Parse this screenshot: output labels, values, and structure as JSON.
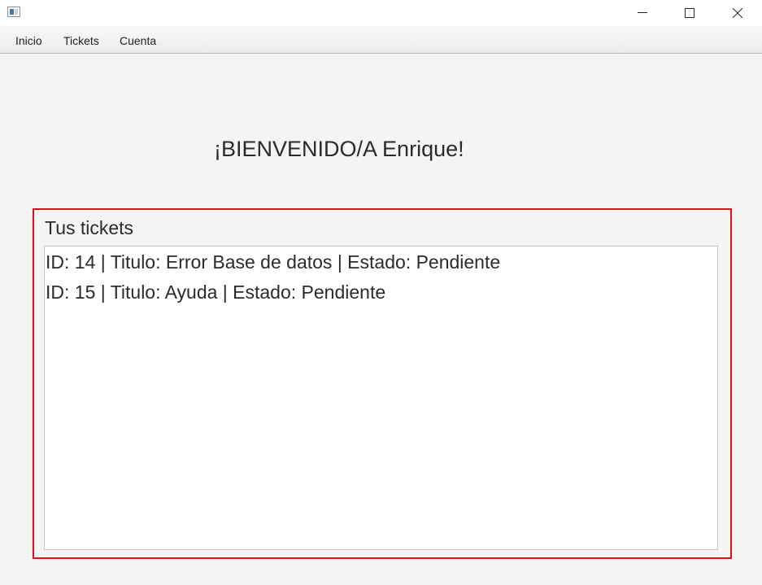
{
  "menubar": {
    "items": [
      {
        "label": "Inicio"
      },
      {
        "label": "Tickets"
      },
      {
        "label": "Cuenta"
      }
    ]
  },
  "main": {
    "welcome_text": "¡BIENVENIDO/A Enrique!",
    "tickets_label": "Tus tickets",
    "tickets": [
      {
        "text": "ID: 14 | Titulo: Error Base de datos | Estado: Pendiente"
      },
      {
        "text": "ID: 15 | Titulo: Ayuda | Estado: Pendiente"
      }
    ]
  },
  "colors": {
    "highlight_border": "#e0101b",
    "window_background": "#f4f4f4",
    "list_background": "#ffffff"
  },
  "icons": {
    "app": "app-window-icon",
    "minimize": "minimize-icon",
    "maximize": "maximize-icon",
    "close": "close-icon"
  }
}
